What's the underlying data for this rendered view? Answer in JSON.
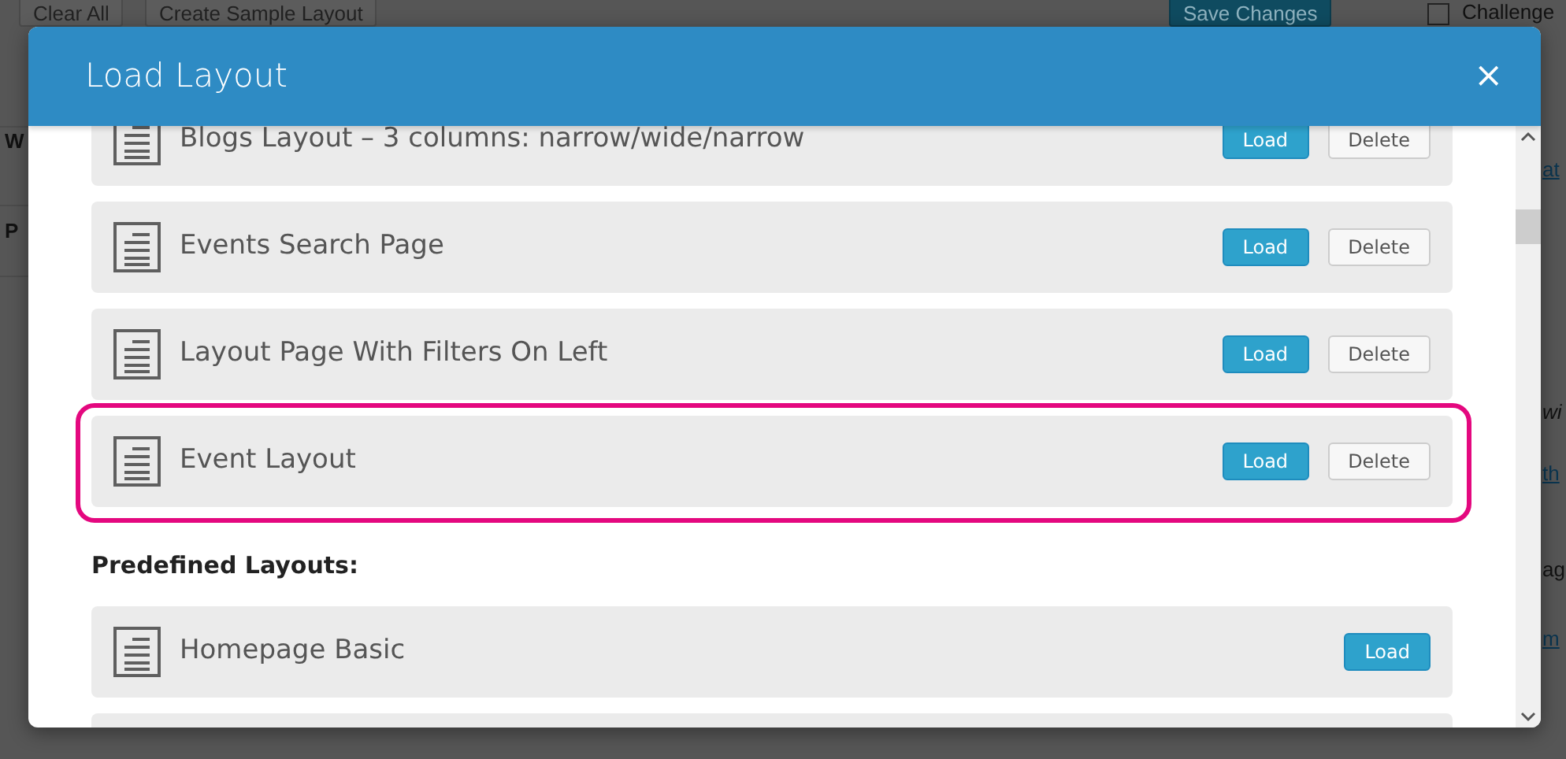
{
  "background": {
    "toolbar_buttons": [
      {
        "label": "Clear All",
        "kind": "plain"
      },
      {
        "label": "Create Sample Layout",
        "kind": "plain"
      },
      {
        "label": "Save Changes",
        "kind": "primary"
      }
    ],
    "checkbox": {
      "label": "Challenge",
      "checked": false
    },
    "left_fragments": [
      "W",
      "P"
    ],
    "right_fragments": [
      {
        "text": "at",
        "kind": "link"
      },
      {
        "text": "wi",
        "kind": "italic"
      },
      {
        "text": "th",
        "kind": "link"
      },
      {
        "text": "ag",
        "kind": "plain"
      },
      {
        "text": "m",
        "kind": "link"
      }
    ]
  },
  "modal": {
    "title": "Load Layout",
    "close": "×",
    "saved_layouts": [
      {
        "name": "Blogs Layout – 3 columns: narrow/wide/narrow",
        "buttons": [
          "Load",
          "Delete"
        ],
        "highlighted": false
      },
      {
        "name": "Events Search Page",
        "buttons": [
          "Load",
          "Delete"
        ],
        "highlighted": false
      },
      {
        "name": "Layout Page With Filters On Left",
        "buttons": [
          "Load",
          "Delete"
        ],
        "highlighted": false
      },
      {
        "name": "Event Layout",
        "buttons": [
          "Load",
          "Delete"
        ],
        "highlighted": true
      }
    ],
    "predefined_heading": "Predefined Layouts:",
    "predefined_layouts": [
      {
        "name": "Homepage Basic",
        "buttons": [
          "Load"
        ],
        "highlighted": false
      },
      {
        "highlighted": false
      }
    ]
  }
}
